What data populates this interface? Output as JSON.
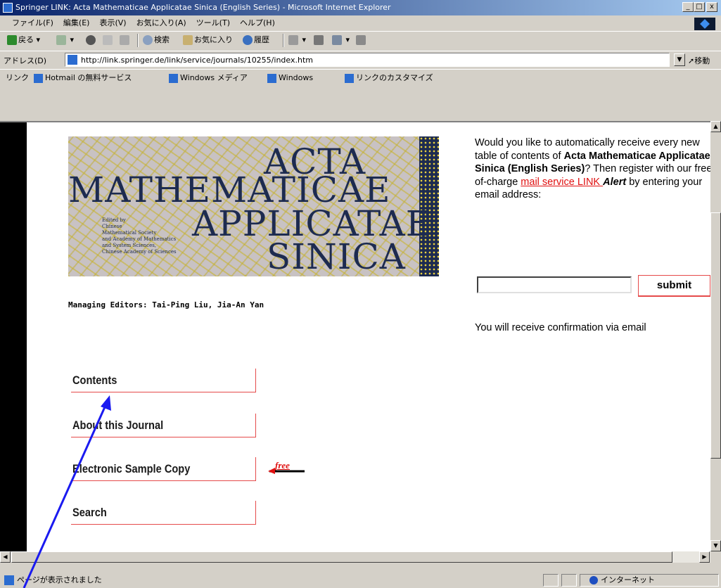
{
  "window": {
    "title": "Springer LINK: Acta Mathematicae Applicatae Sinica (English Series) - Microsoft Internet Explorer",
    "min": "_",
    "max": "□",
    "close": "x"
  },
  "menu": [
    "ファイル(F)",
    "編集(E)",
    "表示(V)",
    "お気に入り(A)",
    "ツール(T)",
    "ヘルプ(H)"
  ],
  "toolbar": {
    "back": "戻る",
    "search": "検索",
    "favorites": "お気に入り",
    "history": "履歴"
  },
  "address": {
    "label": "アドレス(D)",
    "url": "http://link.springer.de/link/service/journals/10255/index.htm",
    "go": "移動"
  },
  "links": {
    "label": "リンク",
    "items": [
      "Hotmail の無料サービス",
      "Windows メディア",
      "Windows",
      "リンクのカスタマイズ"
    ]
  },
  "banner": {
    "line1": "ACTA",
    "line2": "MATHEMATICAE",
    "line3": "APPLICATAE",
    "line4": "SINICA",
    "edited": "Edited by\nChinese\nMathematical Society\nand Academy of Mathematics\nand System Sciences,\nChinese Academy of Sciences"
  },
  "managing_editors": "Managing Editors: Tai-Ping Liu, Jia-An Yan",
  "nav": {
    "contents": "Contents",
    "about": "About this Journal",
    "sample": "Electronic Sample Copy",
    "search": "Search",
    "free": "free"
  },
  "alert": {
    "p1": "Would you like to automatically receive every new table of contents of ",
    "journal": "Acta Mathematicae Applicatae Sinica (English Series)",
    "p2": "? Then register with our free-of-charge ",
    "link": "mail service LINK ",
    "alert_word": "Alert",
    "p3": " by entering your email address:",
    "submit": "submit",
    "confirm": "You will receive confirmation via email"
  },
  "status": {
    "text": "ページが表示されました",
    "zone": "インターネット"
  }
}
